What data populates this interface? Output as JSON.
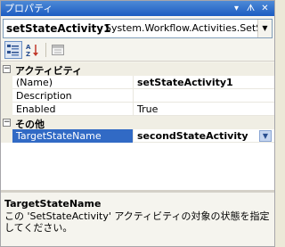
{
  "window": {
    "title": "プロパティ",
    "pin_glyph": "ᗑ",
    "close_glyph": "✕",
    "menu_glyph": "▾"
  },
  "selector": {
    "object_name": "setStateActivity1",
    "object_type": "System.Workflow.Activities.SetStat",
    "drop_glyph": "▼"
  },
  "toolbar": {
    "buttons": [
      {
        "icon": "categorized-icon",
        "active": true
      },
      {
        "icon": "alphabetical-icon",
        "active": false
      },
      {
        "icon": "property-pages-icon",
        "active": false
      }
    ]
  },
  "grid": {
    "categories": [
      {
        "label": "アクティビティ",
        "toggle": "−",
        "properties": [
          {
            "name": "(Name)",
            "value": "setStateActivity1",
            "bold": true
          },
          {
            "name": "Description",
            "value": "",
            "bold": false
          },
          {
            "name": "Enabled",
            "value": "True",
            "bold": false
          }
        ]
      },
      {
        "label": "その他",
        "toggle": "−",
        "properties": [
          {
            "name": "TargetStateName",
            "value": "secondStateActivity",
            "bold": true,
            "selected": true,
            "dropdown": "▼"
          }
        ]
      }
    ]
  },
  "description": {
    "title": "TargetStateName",
    "text": "この 'SetStateActivity' アクティビティの対象の状態を指定してください。"
  },
  "colors": {
    "titlebar": "#1c5cc2",
    "selection": "#316ac5",
    "category_bg": "#f0eee4"
  }
}
